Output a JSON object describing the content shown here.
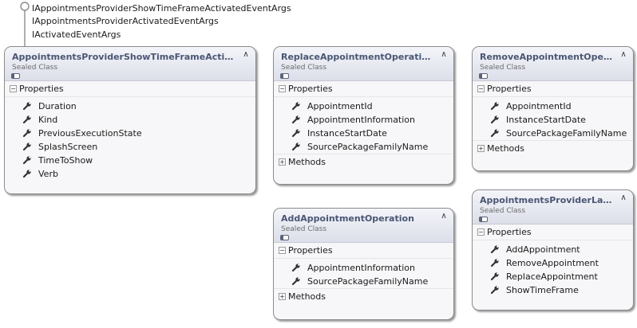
{
  "interfaces": [
    "IAppointmentsProviderShowTimeFrameActivatedEventArgs",
    "IAppointmentsProviderActivatedEventArgs",
    "IActivatedEventArgs"
  ],
  "boxes": {
    "show_time_frame": {
      "title": "AppointmentsProviderShowTimeFrameActivated…",
      "stereotype": "Sealed Class",
      "properties_label": "Properties",
      "properties": [
        "Duration",
        "Kind",
        "PreviousExecutionState",
        "SplashScreen",
        "TimeToShow",
        "Verb"
      ]
    },
    "replace": {
      "title": "ReplaceAppointmentOperation",
      "stereotype": "Sealed Class",
      "properties_label": "Properties",
      "properties": [
        "AppointmentId",
        "AppointmentInformation",
        "InstanceStartDate",
        "SourcePackageFamilyName"
      ],
      "methods_label": "Methods"
    },
    "remove": {
      "title": "RemoveAppointmentOperat…",
      "stereotype": "Sealed Class",
      "properties_label": "Properties",
      "properties": [
        "AppointmentId",
        "InstanceStartDate",
        "SourcePackageFamilyName"
      ],
      "methods_label": "Methods"
    },
    "add": {
      "title": "AddAppointmentOperation",
      "stereotype": "Sealed Class",
      "properties_label": "Properties",
      "properties": [
        "AppointmentInformation",
        "SourcePackageFamilyName"
      ],
      "methods_label": "Methods"
    },
    "launch": {
      "title": "AppointmentsProviderLaunc…",
      "stereotype": "Sealed Class",
      "properties_label": "Properties",
      "properties": [
        "AddAppointment",
        "RemoveAppointment",
        "ReplaceAppointment",
        "ShowTimeFrame"
      ]
    }
  }
}
